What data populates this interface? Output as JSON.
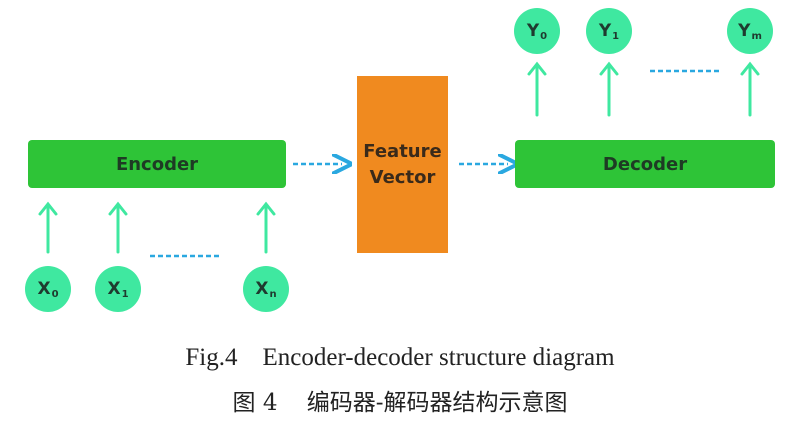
{
  "diagram": {
    "encoder_label": "Encoder",
    "decoder_label": "Decoder",
    "feature_line1": "Feature",
    "feature_line2": "Vector",
    "inputs": [
      {
        "base": "X",
        "sub": "0"
      },
      {
        "base": "X",
        "sub": "1"
      },
      {
        "base": "X",
        "sub": "n"
      }
    ],
    "outputs": [
      {
        "base": "Y",
        "sub": "0"
      },
      {
        "base": "Y",
        "sub": "1"
      },
      {
        "base": "Y",
        "sub": "m"
      }
    ]
  },
  "caption": {
    "english": "Fig.4    Encoder-decoder structure diagram",
    "chinese": "图 4    编码器-解码器结构示意图"
  },
  "colors": {
    "node": "#3fe8a0",
    "bar": "#2ec437",
    "feature_box": "#f08a1f",
    "arrow": "#3fe8a0",
    "dashed": "#2aa8e0"
  }
}
